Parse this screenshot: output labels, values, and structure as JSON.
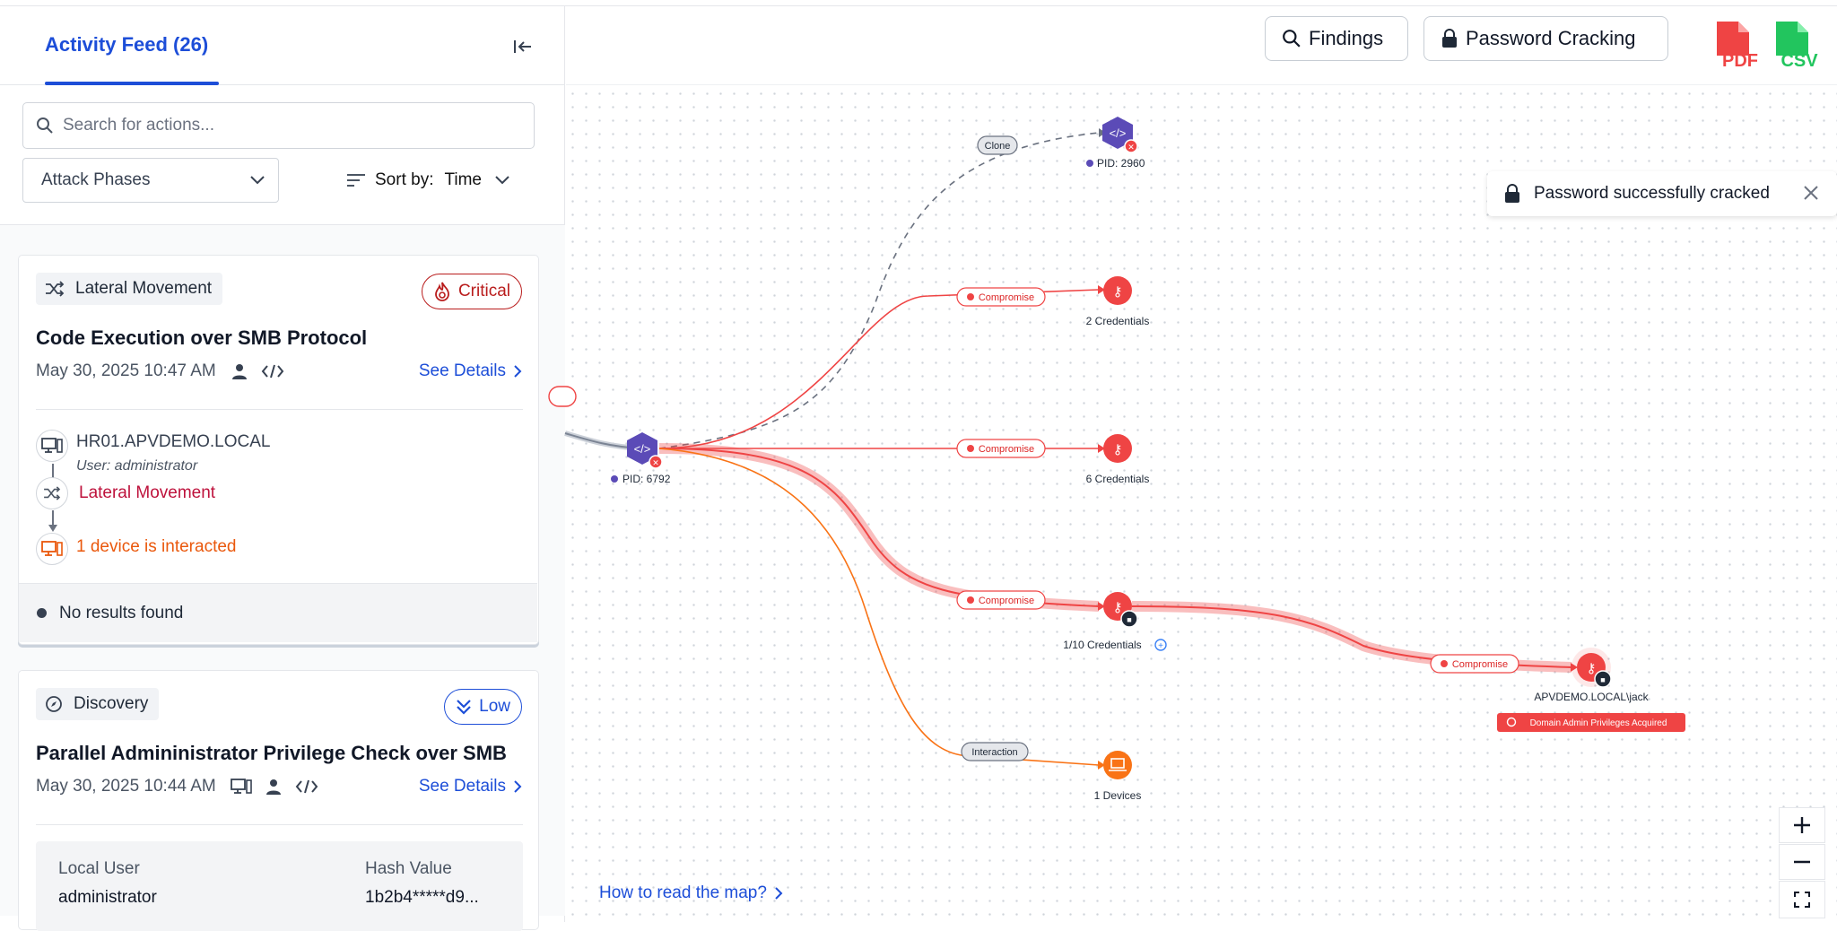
{
  "sidebar": {
    "tab_label": "Activity Feed (26)",
    "search_placeholder": "Search for actions...",
    "filter_select": "Attack Phases",
    "sort_label": "Sort by:",
    "sort_value": "Time"
  },
  "cards": [
    {
      "phase": "Lateral Movement",
      "severity": "Critical",
      "title": "Code Execution over SMB Protocol",
      "timestamp": "May 30, 2025 10:47 AM",
      "details_link": "See Details",
      "host": "HR01.APVDEMO.LOCAL",
      "user": "User: administrator",
      "action": "Lateral Movement",
      "result": "1 device is interacted",
      "no_results": "No results found"
    },
    {
      "phase": "Discovery",
      "severity": "Low",
      "title": "Parallel Admininistrator Privilege Check over SMB",
      "timestamp": "May 30, 2025 10:44 AM",
      "details_link": "See Details",
      "table_headers": [
        "Local User",
        "Hash Value"
      ],
      "table_values": [
        "administrator",
        "1b2b4*****d9..."
      ]
    }
  ],
  "toolbar": {
    "findings": "Findings",
    "password_cracking": "Password Cracking",
    "pdf_label": "PDF",
    "csv_label": "CSV"
  },
  "toast": {
    "message": "Password successfully cracked"
  },
  "map": {
    "edge_labels": {
      "clone": "Clone",
      "compromise": "Compromise",
      "interaction": "Interaction"
    },
    "nodes": {
      "pid_main": "PID: 6792",
      "pid_child": "PID: 2960",
      "cred_a": "2 Credentials",
      "cred_b": "6 Credentials",
      "cred_c": "1/10 Credentials",
      "devices": "1 Devices",
      "target_user": "APVDEMO.LOCAL\\jack",
      "target_badge": "Domain Admin Privileges Acquired"
    },
    "help_link": "How to read the map?"
  },
  "colors": {
    "accent": "#1d4ed8",
    "critical": "#b91c1c",
    "compromise": "#ef4444",
    "interaction": "#f97316",
    "process_node": "#5b4bb7"
  }
}
